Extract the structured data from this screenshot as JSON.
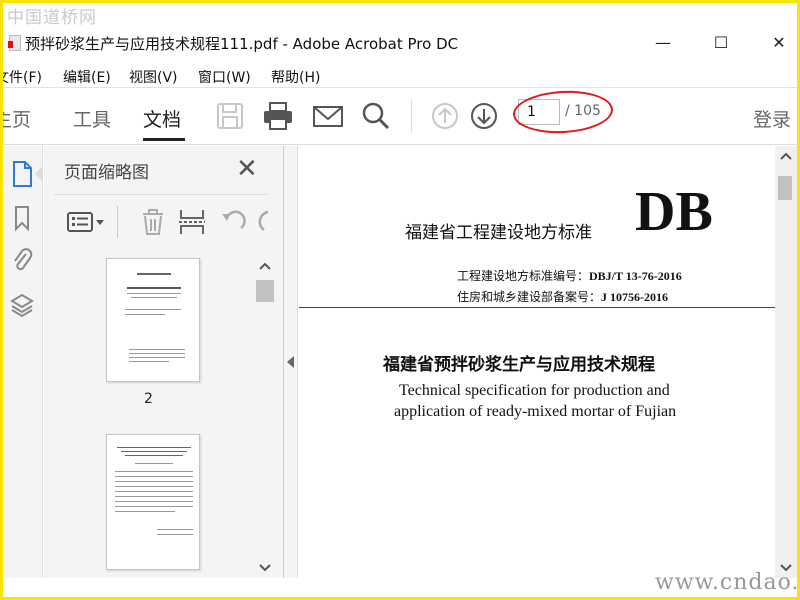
{
  "watermark_top": "中国道桥网",
  "watermark_bottom": "www.cndao.com",
  "window": {
    "title": "预拌砂浆生产与应用技术规程111.pdf - Adobe Acrobat Pro DC",
    "min_glyph": "—",
    "max_glyph": "☐",
    "close_glyph": "✕"
  },
  "menu": {
    "items": [
      "文件(F)",
      "编辑(E)",
      "视图(V)",
      "窗口(W)",
      "帮助(H)"
    ]
  },
  "toolbar": {
    "tabs": [
      "主页",
      "工具",
      "文档"
    ],
    "active_tab": "文档",
    "current_page": "1",
    "total_pages": "/ 105",
    "sign_in": "登录"
  },
  "left_rail": {
    "icons": [
      "page-thumbnails-icon",
      "bookmark-icon",
      "attachment-icon",
      "layers-icon"
    ]
  },
  "thumbnail_panel": {
    "title": "页面缩略图",
    "close_glyph": "✕",
    "tool_icons": [
      "options-menu-icon",
      "delete-icon",
      "extract-icon",
      "undo-icon",
      "redo-icon"
    ],
    "thumbnails": [
      {
        "label": "2"
      },
      {
        "label": ""
      }
    ]
  },
  "document": {
    "header_label": "福建省工程建设地方标准",
    "header_code": "DB",
    "code_line1_prefix": "工程建设地方标准编号：",
    "code_line1_value": "DBJ/T 13-76-2016",
    "code_line2_prefix": "住房和城乡建设部备案号：",
    "code_line2_value": "J 10756-2016",
    "title_cn": "福建省预拌砂浆生产与应用技术规程",
    "title_en_line1": "Technical specification for production and",
    "title_en_line2": "application of ready-mixed mortar of Fujian"
  },
  "colors": {
    "highlight_ellipse": "#e0191a",
    "frame_border": "#f7e600"
  }
}
